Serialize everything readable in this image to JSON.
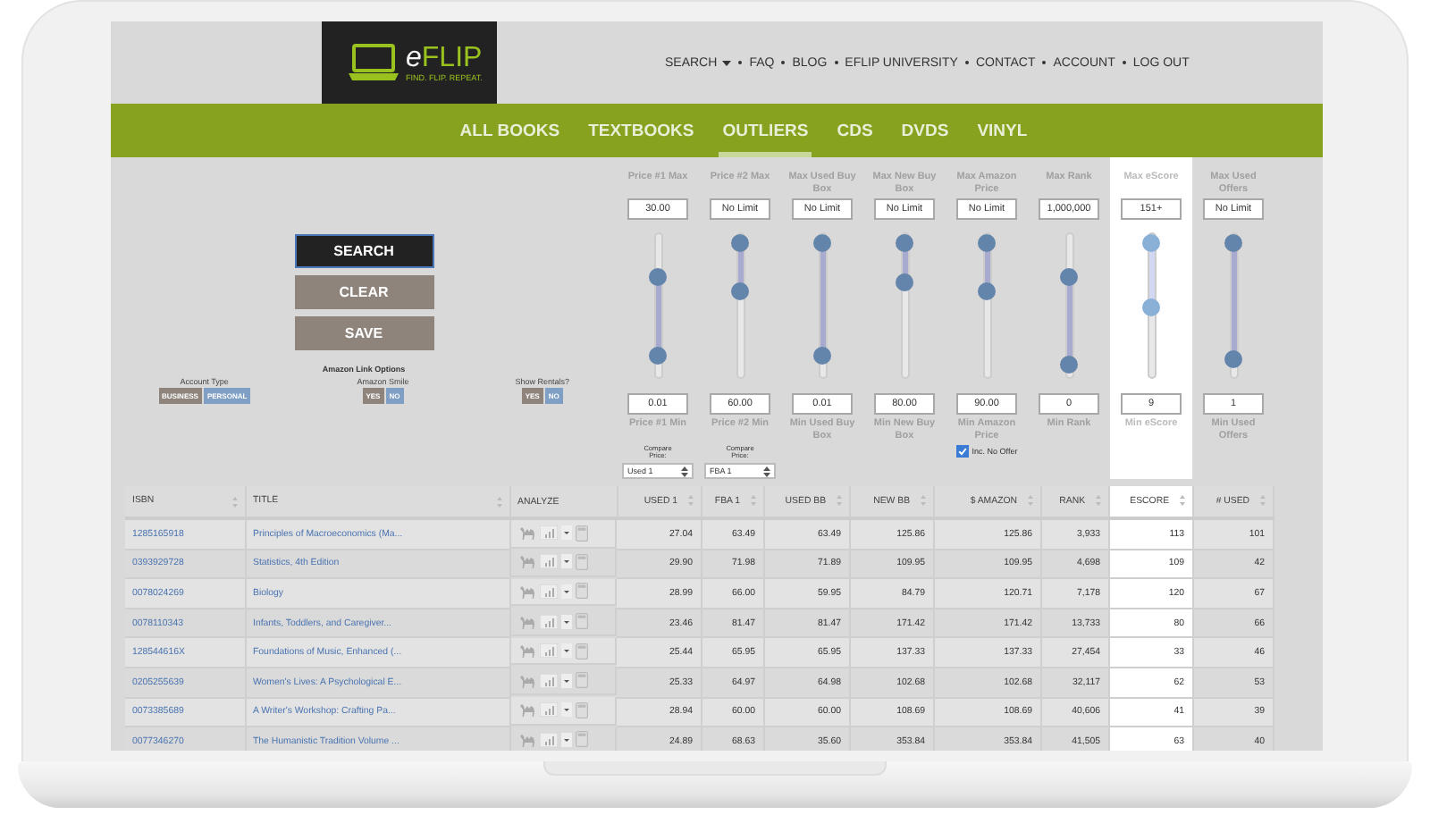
{
  "logo": {
    "name": "eFLIP",
    "tagline": "FIND. FLIP. REPEAT."
  },
  "top_nav": [
    {
      "label": "SEARCH",
      "dropdown": true
    },
    {
      "label": "FAQ",
      "dropdown": false
    },
    {
      "label": "BLOG",
      "dropdown": false
    },
    {
      "label": "EFLIP UNIVERSITY",
      "dropdown": false
    },
    {
      "label": "CONTACT",
      "dropdown": false
    },
    {
      "label": "ACCOUNT",
      "dropdown": false
    },
    {
      "label": "LOG OUT",
      "dropdown": false
    }
  ],
  "tabs": [
    {
      "label": "ALL BOOKS",
      "selected": false
    },
    {
      "label": "TEXTBOOKS",
      "selected": false
    },
    {
      "label": "OUTLIERS",
      "selected": true
    },
    {
      "label": "CDS",
      "selected": false
    },
    {
      "label": "DVDS",
      "selected": false
    },
    {
      "label": "VINYL",
      "selected": false
    }
  ],
  "actions": [
    "SEARCH",
    "CLEAR",
    "SAVE"
  ],
  "link_options": {
    "title": "Amazon Link Options",
    "groups": [
      {
        "label": "Account Type",
        "options": [
          {
            "label": "BUSINESS",
            "selected": false
          },
          {
            "label": "PERSONAL",
            "selected": true
          }
        ]
      },
      {
        "label": "Amazon Smile",
        "options": [
          {
            "label": "YES",
            "selected": false
          },
          {
            "label": "NO",
            "selected": true
          }
        ]
      },
      {
        "label": "Show Rentals?",
        "options": [
          {
            "label": "YES",
            "selected": false
          },
          {
            "label": "NO",
            "selected": true
          }
        ]
      }
    ]
  },
  "filters": [
    {
      "max_label": "Price #1 Max",
      "max_value": "30.00",
      "max_thumb": {
        "level": 0.73
      },
      "min_thumb": {
        "level": 0.1
      },
      "min_value": "0.01",
      "min_label": "Price #1 Min",
      "highlighted": false,
      "extra": {
        "kind": "select",
        "label": "Compare Price:",
        "value": "Used 1"
      }
    },
    {
      "max_label": "Price #2 Max",
      "max_value": "No Limit",
      "max_thumb": {
        "level": 1
      },
      "min_thumb": {
        "level": 0.61
      },
      "min_value": "60.00",
      "min_label": "Price #2 Min",
      "highlighted": false,
      "extra": {
        "kind": "select",
        "label": "Compare Price:",
        "value": "FBA 1"
      }
    },
    {
      "max_label": "Max Used Buy Box",
      "max_value": "No Limit",
      "max_thumb": {
        "level": 1
      },
      "min_thumb": {
        "level": 0.1
      },
      "min_value": "0.01",
      "min_label": "Min Used Buy Box",
      "highlighted": false
    },
    {
      "max_label": "Max New Buy Box",
      "max_value": "No Limit",
      "max_thumb": {
        "level": 1
      },
      "min_thumb": {
        "level": 0.68
      },
      "min_value": "80.00",
      "min_label": "Min New Buy Box",
      "highlighted": false
    },
    {
      "max_label": "Max Amazon Price",
      "max_value": "No Limit",
      "max_thumb": {
        "level": 1
      },
      "min_thumb": {
        "level": 0.61
      },
      "min_value": "90.00",
      "min_label": "Min Amazon Price",
      "highlighted": false,
      "extra": {
        "kind": "checkbox",
        "label": "Inc. No Offer",
        "checked": true
      }
    },
    {
      "max_label": "Max Rank",
      "max_value": "1,000,000",
      "max_thumb": {
        "level": 0.73
      },
      "min_thumb": {
        "level": 0.03
      },
      "min_value": "0",
      "min_label": "Min Rank",
      "highlighted": false
    },
    {
      "max_label": "Max eScore",
      "max_value": "151+",
      "max_thumb": {
        "level": 1
      },
      "min_thumb": {
        "level": 0.48
      },
      "min_value": "9",
      "min_label": "Min eScore",
      "highlighted": true
    },
    {
      "max_label": "Max Used Offers",
      "max_value": "No Limit",
      "max_thumb": {
        "level": 1
      },
      "min_thumb": {
        "level": 0.07
      },
      "min_value": "1",
      "min_label": "Min Used Offers",
      "highlighted": false
    }
  ],
  "table": {
    "columns": [
      {
        "label": "ISBN",
        "highlighted": false
      },
      {
        "label": "TITLE",
        "highlighted": false
      },
      {
        "label": "ANALYZE",
        "highlighted": false
      },
      {
        "label": "USED 1",
        "highlighted": false
      },
      {
        "label": "FBA 1",
        "highlighted": false
      },
      {
        "label": "USED BB",
        "highlighted": false
      },
      {
        "label": "NEW BB",
        "highlighted": false
      },
      {
        "label": "$ AMAZON",
        "highlighted": false
      },
      {
        "label": "RANK",
        "highlighted": false
      },
      {
        "label": "ESCORE",
        "highlighted": true
      },
      {
        "label": "# USED",
        "highlighted": false
      }
    ],
    "rows": [
      {
        "isbn": "1285165918",
        "title": "Principles of Macroeconomics (Ma...",
        "values": [
          "27.04",
          "63.49",
          "63.49",
          "125.86",
          "125.86",
          "3,933",
          "113",
          "101"
        ]
      },
      {
        "isbn": "0393929728",
        "title": "Statistics, 4th Edition",
        "values": [
          "29.90",
          "71.98",
          "71.89",
          "109.95",
          "109.95",
          "4,698",
          "109",
          "42"
        ]
      },
      {
        "isbn": "0078024269",
        "title": "Biology",
        "values": [
          "28.99",
          "66.00",
          "59.95",
          "84.79",
          "120.71",
          "7,178",
          "120",
          "67"
        ]
      },
      {
        "isbn": "0078110343",
        "title": "Infants, Toddlers, and Caregiver...",
        "values": [
          "23.46",
          "81.47",
          "81.47",
          "171.42",
          "171.42",
          "13,733",
          "80",
          "66"
        ]
      },
      {
        "isbn": "128544616X",
        "title": "Foundations of Music, Enhanced (...",
        "values": [
          "25.44",
          "65.95",
          "65.95",
          "137.33",
          "137.33",
          "27,454",
          "33",
          "46"
        ]
      },
      {
        "isbn": "0205255639",
        "title": "Women's Lives: A Psychological E...",
        "values": [
          "25.33",
          "64.97",
          "64.98",
          "102.68",
          "102.68",
          "32,117",
          "62",
          "53"
        ]
      },
      {
        "isbn": "0073385689",
        "title": "A Writer's Workshop: Crafting Pa...",
        "values": [
          "28.94",
          "60.00",
          "60.00",
          "108.69",
          "108.69",
          "40,606",
          "41",
          "39"
        ]
      },
      {
        "isbn": "0077346270",
        "title": "The Humanistic Tradition Volume ...",
        "values": [
          "24.89",
          "68.63",
          "35.60",
          "353.84",
          "353.84",
          "41,505",
          "63",
          "40"
        ]
      }
    ]
  }
}
